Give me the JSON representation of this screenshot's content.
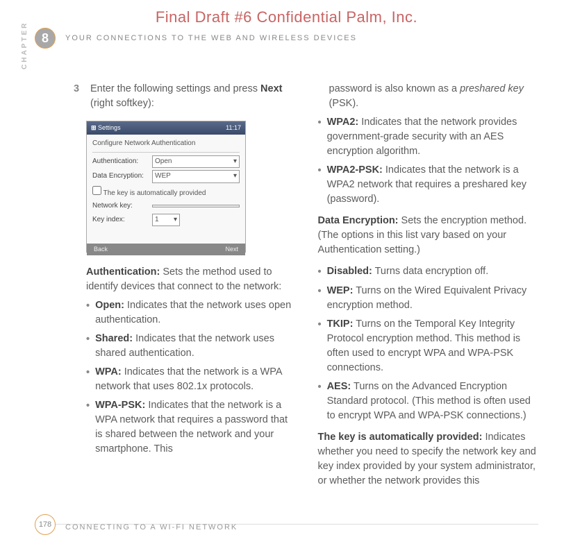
{
  "watermark": "Final Draft #6     Confidential     Palm, Inc.",
  "chapter_number": "8",
  "chapter_label": "CHAPTER",
  "header_subtitle": "YOUR CONNECTIONS TO THE WEB AND WIRELESS DEVICES",
  "step": {
    "num": "3",
    "text_a": "Enter the following settings and press ",
    "text_b": "Next",
    "text_c": " (right softkey):"
  },
  "screenshot": {
    "title_left": "Settings",
    "title_right": "11:17",
    "heading": "Configure Network Authentication",
    "row1_label": "Authentication:",
    "row1_value": "Open",
    "row2_label": "Data Encryption:",
    "row2_value": "WEP",
    "checkbox": "The key is automatically provided",
    "row3_label": "Network key:",
    "row4_label": "Key index:",
    "row4_value": "1",
    "btn_left": "Back",
    "btn_right": "Next"
  },
  "auth": {
    "head": "Authentication:",
    "text": " Sets the method used to identify devices that connect to the network:"
  },
  "auth_items": [
    {
      "b": "Open:",
      "t": " Indicates that the network uses open authentication."
    },
    {
      "b": "Shared:",
      "t": " Indicates that the network uses shared authentication."
    },
    {
      "b": "WPA:",
      "t": " Indicates that the network is a WPA network that uses 802.1x protocols."
    },
    {
      "b": "WPA-PSK:",
      "t": " Indicates that the network is a WPA network that requires a password that is shared between the network and your smartphone. This"
    }
  ],
  "col2_cont_a": "password is also known as a ",
  "col2_cont_i": "preshared key",
  "col2_cont_b": " (PSK).",
  "col2_items": [
    {
      "b": "WPA2:",
      "t": " Indicates that the network provides government-grade security with an AES encryption algorithm."
    },
    {
      "b": "WPA2-PSK:",
      "t": " Indicates that the network is a WPA2 network that requires a preshared key (password)."
    }
  ],
  "dataenc": {
    "head": "Data Encryption:",
    "text": " Sets the encryption method. (The options in this list vary based on your Authentication setting.)"
  },
  "enc_items": [
    {
      "b": "Disabled:",
      "t": " Turns data encryption off."
    },
    {
      "b": "WEP:",
      "t": " Turns on the Wired Equivalent Privacy encryption method."
    },
    {
      "b": "TKIP:",
      "t": " Turns on the Temporal Key Integrity Protocol encryption method. This method is often used to encrypt WPA and WPA-PSK connections."
    },
    {
      "b": "AES:",
      "t": " Turns on the Advanced Encryption Standard protocol. (This method is often used to encrypt WPA and WPA-PSK connections.)"
    }
  ],
  "keyauto": {
    "head": "The key is automatically provided:",
    "text": " Indicates whether you need to specify the network key and key index provided by your system administrator, or whether the network provides this"
  },
  "footer": {
    "page": "178",
    "text": "CONNECTING TO A WI-FI NETWORK"
  }
}
